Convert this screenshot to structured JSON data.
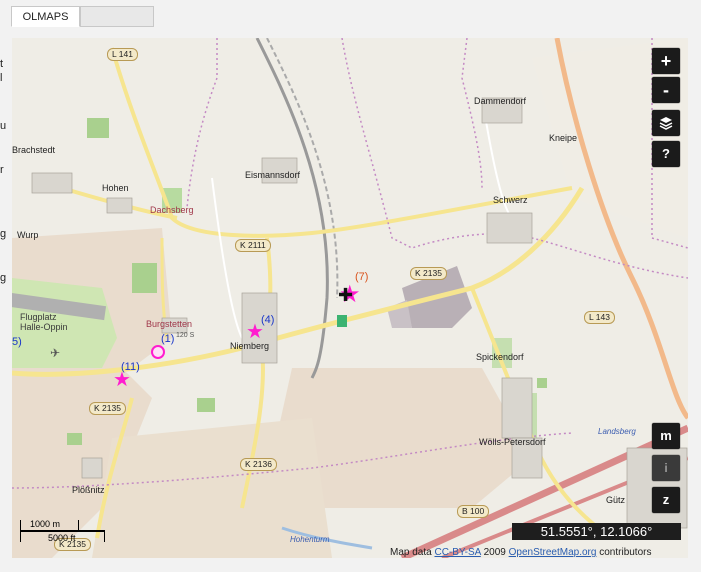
{
  "tabs": [
    "OLMAPS",
    ""
  ],
  "controls": {
    "zoom_in": "+",
    "zoom_out": "-",
    "layers": "layers-icon",
    "help": "?",
    "m": "m",
    "i": "i",
    "z": "z"
  },
  "coordinates": "51.5551°, 12.1066°",
  "attribution": {
    "prefix": "Map data",
    "license": "CC-BY-SA",
    "year": "2009",
    "source": "OpenStreetMap.org",
    "suffix": "contributors"
  },
  "scale": {
    "metric": "1000 m",
    "imperial": "5000 ft"
  },
  "places": {
    "brachstedt": "Brachstedt",
    "hohen": "Hohen",
    "dachsberg": "Dachsberg",
    "wurp": "Wurp",
    "eismannsdorf": "Eismannsdorf",
    "dammendorf": "Dammendorf",
    "kneipe": "Kneipe",
    "schwerz": "Schwerz",
    "flugplatz": "Flugplatz\nHalle-Oppin",
    "burgstetten": "Burgstetten",
    "niemberg": "Niemberg",
    "spickendorf": "Spickendorf",
    "woells": "Wölls-Petersdorf",
    "ploessnitz": "Plößnitz",
    "landsberg": "Landsberg",
    "guetz": "Gütz",
    "hohenturm": "Hohenturm",
    "dachsberg_height": "120 S"
  },
  "roads": [
    "L 141",
    "K 2111",
    "K 2135",
    "L 143",
    "K 2135",
    "K 2136",
    "B 100",
    "K 2135"
  ],
  "markers": {
    "m7": "(7)",
    "m4": "(4)",
    "m1": "(1)",
    "m11": "(11)",
    "m5": "5)"
  },
  "left_peek": [
    "t",
    "l",
    "u",
    "r",
    "g",
    "g"
  ]
}
